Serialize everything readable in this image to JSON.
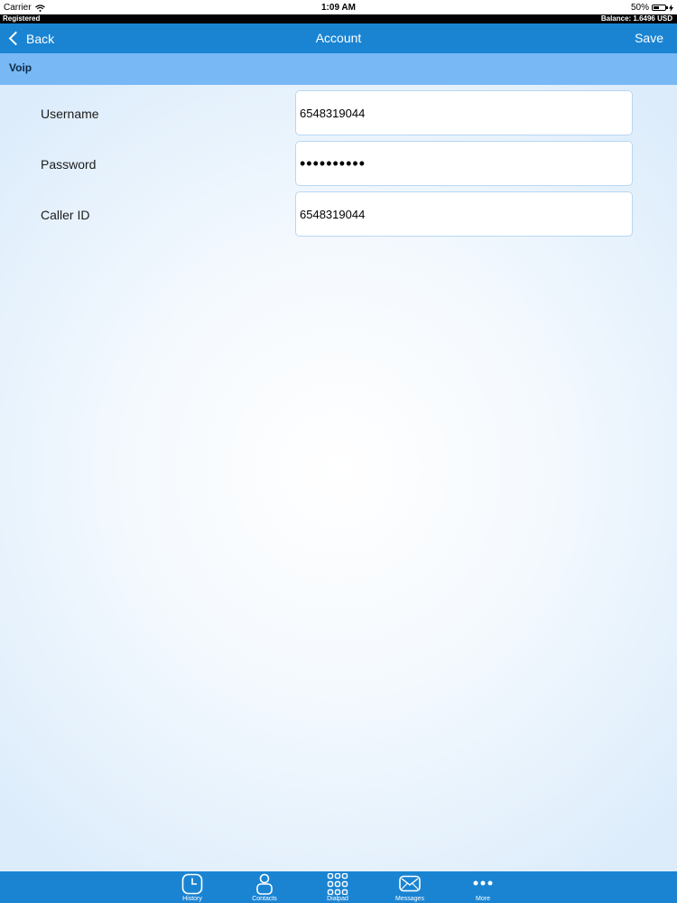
{
  "status_bar": {
    "carrier": "Carrier",
    "time": "1:09 AM",
    "battery": "50%"
  },
  "reg_bar": {
    "status": "Registered",
    "balance": "Balance: 1.6496 USD"
  },
  "nav": {
    "back_label": "Back",
    "title": "Account",
    "save_label": "Save"
  },
  "section": {
    "title": "Voip"
  },
  "form": {
    "username_label": "Username",
    "username_value": "6548319044",
    "password_label": "Password",
    "password_value": "••••••••••",
    "caller_id_label": "Caller ID",
    "caller_id_value": "6548319044"
  },
  "tabs": [
    {
      "label": "History",
      "icon": "clock-icon"
    },
    {
      "label": "Contacts",
      "icon": "person-icon"
    },
    {
      "label": "Dialpad",
      "icon": "keypad-icon"
    },
    {
      "label": "Messages",
      "icon": "envelope-icon"
    },
    {
      "label": "More",
      "icon": "more-dots-icon"
    }
  ],
  "colors": {
    "nav_bar": "#1a84d3",
    "section_header": "#77b8f5",
    "background": "#eaf4fd"
  }
}
